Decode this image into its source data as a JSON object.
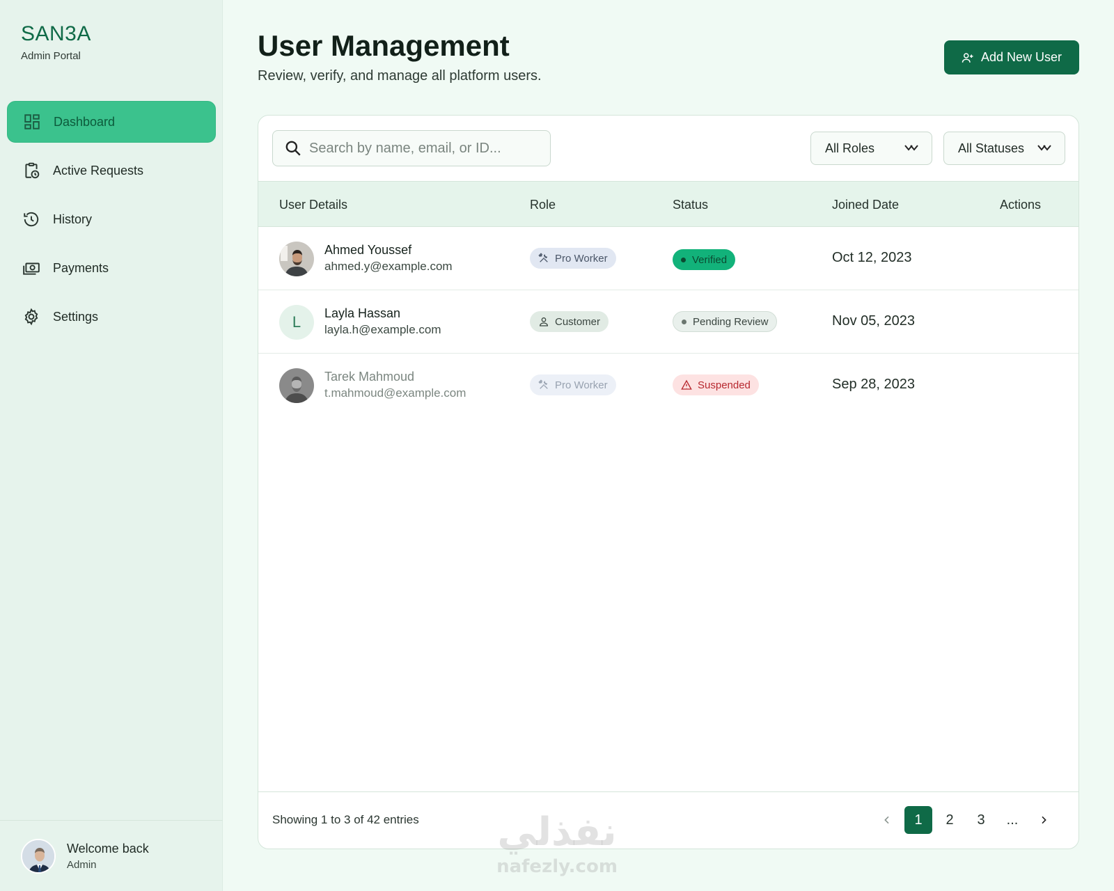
{
  "brand": {
    "name": "SAN3A",
    "subtitle": "Admin Portal"
  },
  "sidebar": {
    "items": [
      {
        "label": "Dashboard",
        "icon": "dashboard-grid-icon",
        "active": true
      },
      {
        "label": "Active Requests",
        "icon": "clipboard-clock-icon"
      },
      {
        "label": "History",
        "icon": "history-icon"
      },
      {
        "label": "Payments",
        "icon": "payments-icon"
      },
      {
        "label": "Settings",
        "icon": "gear-icon"
      }
    ],
    "footer": {
      "greeting": "Welcome back",
      "role": "Admin"
    }
  },
  "header": {
    "title": "User Management",
    "subtitle": "Review, verify, and manage all platform users.",
    "add_button": "Add New User"
  },
  "filters": {
    "search_placeholder": "Search by name, email, or ID...",
    "roles": "All Roles",
    "statuses": "All Statuses"
  },
  "table": {
    "columns": [
      "User Details",
      "Role",
      "Status",
      "Joined Date",
      "Actions"
    ],
    "rows": [
      {
        "name": "Ahmed Youssef",
        "email": "ahmed.y@example.com",
        "role": "Pro Worker",
        "status": "Verified",
        "joined": "Oct 12, 2023"
      },
      {
        "name": "Layla Hassan",
        "email": "layla.h@example.com",
        "initial": "L",
        "role": "Customer",
        "status": "Pending Review",
        "joined": "Nov 05, 2023"
      },
      {
        "name": "Tarek Mahmoud",
        "email": "t.mahmoud@example.com",
        "role": "Pro Worker",
        "status": "Suspended",
        "joined": "Sep 28, 2023"
      }
    ]
  },
  "pagination": {
    "summary": "Showing 1 to 3 of 42 entries",
    "pages": [
      "1",
      "2",
      "3",
      "..."
    ],
    "current": "1"
  },
  "watermark": {
    "arabic": "نفذلي",
    "latin": "nafezly.com"
  },
  "colors": {
    "brand_green": "#0f6a47",
    "active_nav": "#3bc28d",
    "verified": "#12b27a",
    "suspended_bg": "#fde2e2",
    "suspended_text": "#b7282f"
  }
}
